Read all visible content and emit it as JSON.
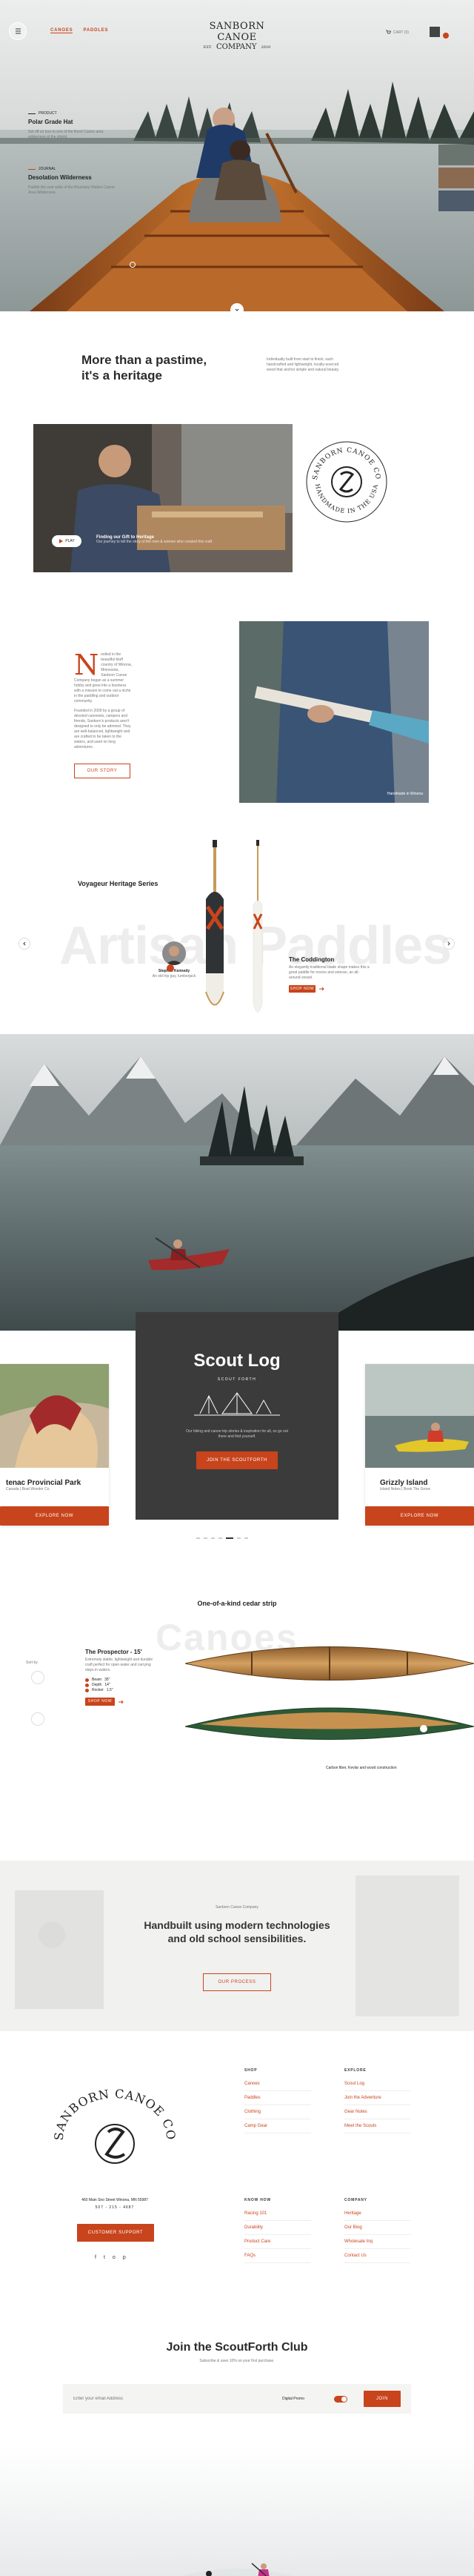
{
  "header": {
    "nav": [
      "CANOES",
      "PADDLES"
    ],
    "logo_line1": "SANBORN CANOE",
    "logo_line2": "COMPANY",
    "logo_est_left": "EST.",
    "logo_est_right": "2010",
    "cart_label": "CART (0)"
  },
  "hero": {
    "items": [
      {
        "tag": "PRODUCT",
        "title": "Polar Grade Hat",
        "text": "Set off on tour to one of the finest Canoe area wilderness of the shield."
      },
      {
        "tag": "JOURNAL",
        "title": "Desolation Wilderness",
        "text": "Paddle the vast wilds of the Boundary Waters Canoe Area Wilderness."
      }
    ]
  },
  "heritage": {
    "heading_line1": "More than a pastime,",
    "heading_line2": "it's a heritage",
    "text": "Individually built from start to finish, each handcrafted and lightweight, locally-sourced wood that anchor simple and natural beauty.",
    "video_chip": "PLAY",
    "video_title": "Finding our Gift to Heritage",
    "video_sub": "Our journey to tell the story of the men & women who created this craft",
    "badge_top": "SANBORN CANOE CO",
    "badge_bottom": "HANDMADE IN THE USA",
    "drop_cap": "N",
    "story_p1": "estled in the beautiful bluff country of Winona, Minnesota, Sanborn Canoe Company began as a summer hobby and grew into a business with a mission to come out a niche in the paddling and outdoor community.",
    "story_p2": "Founded in 2009 by a group of devoted canoeists, campers and friends, Sanborn's products aren't designed to only be admired. They are well-balanced, lightweight and are crafted to be taken to the waters, and used on long adventures.",
    "story_button": "OUR STORY",
    "photo_caption": "Handmade in Winona"
  },
  "paddles": {
    "series_title": "Voyageur Heritage Series",
    "bg_word": "Artisan Paddles",
    "person_name": "Stephen Kennedy",
    "person_role": "An old trip guy, lumberjack",
    "product_name": "The Coddington",
    "product_desc": "An elegantly traditional blade shape makes this a great paddle for novice and veteran, an all-around vessel.",
    "product_btn": "SHOP NOW",
    "side_label": "Side text"
  },
  "scout_log": {
    "title": "Scout Log",
    "subtitle": "SCOUT FORTH",
    "text": "Our hiking and canoe trip stories & inspiration for all, so go out there and find yourself.",
    "button": "JOIN THE SCOUTFORTH",
    "left_card_title": "tenac Provincial Park",
    "left_card_sub": "Canada | Boat Wonder Co.",
    "left_card_btn": "EXPLORE NOW",
    "right_card_title": "Grizzly Island",
    "right_card_sub": "Island Notes | Book The Grove",
    "right_card_btn": "EXPLORE NOW"
  },
  "canoes": {
    "heading": "One-of-a-kind cedar strip",
    "bg_word": "Canoes",
    "side_label": "Sort by",
    "product_name": "The Prospector - 15'",
    "product_desc": "Extremely stable, lightweight and durable craft perfect for open water and carrying stays in waters.",
    "specs": [
      {
        "label": "Beam",
        "value": "35\""
      },
      {
        "label": "Depth",
        "value": "14\""
      },
      {
        "label": "Rocker",
        "value": "1.5\""
      }
    ],
    "btn": "SHOP NOW",
    "caption": "Carbon fiber, Kevlar and wood construction"
  },
  "handbuilt": {
    "eyebrow": "Sanborn Canoe Company",
    "line1": "Handbuilt using modern technologies",
    "line2": "and old school sensibilities.",
    "button": "OUR PROCESS"
  },
  "footer": {
    "brand_top": "SANBORN CANOE CO",
    "address": "460 Main Sno Street Winona, MN 55987",
    "phone": "507 - 215 - 4687",
    "button": "CUSTOMER SUPPORT",
    "socials": [
      "f",
      "t",
      "o",
      "p"
    ],
    "cols": [
      {
        "title": "SHOP",
        "items": [
          "Canoes",
          "Paddles",
          "Clothing",
          "Camp Gear"
        ]
      },
      {
        "title": "EXPLORE",
        "items": [
          "Scout Log",
          "Join the Adventure",
          "Gear Notes",
          "Meet the Scouts"
        ]
      },
      {
        "title": "KNOW HOW",
        "items": [
          "Racing 101",
          "Durability",
          "Product Care",
          "FAQs"
        ]
      },
      {
        "title": "COMPANY",
        "items": [
          "Heritage",
          "Our Blog",
          "Wholesale Inq",
          "Contact Us"
        ]
      }
    ]
  },
  "club": {
    "title": "Join the ScoutForth Club",
    "subtitle": "Subscribe & save 10% on your first purchase.",
    "placeholder": "Enter your email Address",
    "toggle_label": "Digital Promo",
    "button": "JOIN"
  },
  "colors": {
    "accent": "#c8441c",
    "dark": "#3c3b3b"
  }
}
